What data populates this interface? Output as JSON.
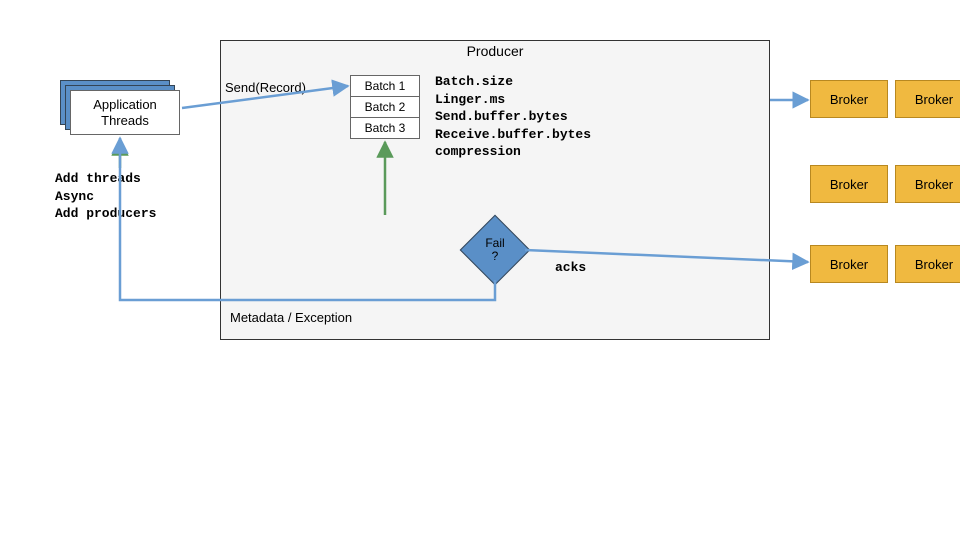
{
  "producer_title": "Producer",
  "app_threads_label": "Application\nThreads",
  "send_label": "Send(Record)",
  "batches": [
    "Batch 1",
    "Batch 2",
    "Batch 3"
  ],
  "config_lines": [
    "Batch.size",
    "Linger.ms",
    "Send.buffer.bytes",
    "Receive.buffer.bytes",
    "compression"
  ],
  "hints_lines": [
    "Add threads",
    "Async",
    "Add producers"
  ],
  "fail_label": "Fail\n?",
  "acks_label": "acks",
  "metadata_label": "Metadata / Exception",
  "broker_label": "Broker",
  "colors": {
    "broker_bg": "#f0b940",
    "broker_border": "#b88820",
    "card_bg": "#5a8fc7",
    "arrow_blue": "#6a9ed4",
    "arrow_green": "#5a9a5a"
  }
}
